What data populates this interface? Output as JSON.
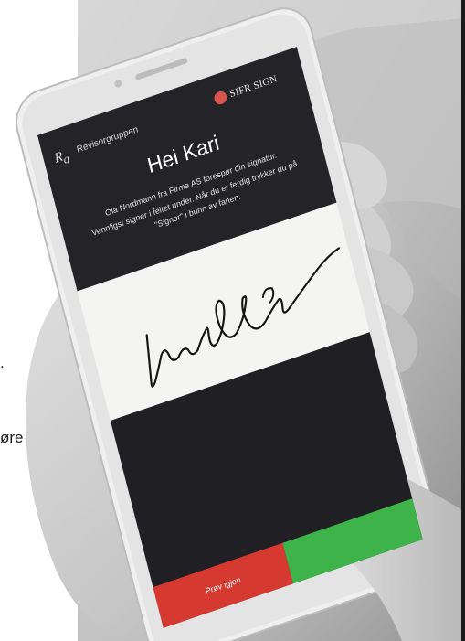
{
  "left_text": {
    "line1": ".",
    "line2": "øre"
  },
  "app": {
    "org_name": "Revisorgruppen",
    "brand_name": "SIFR SIGN",
    "greeting": "Hei Kari",
    "request": "Ola Nordmann fra Firma AS forespør din signatur.",
    "instruction_line1": "Vennligst signer i feltet under. Når du er ferdig trykker du på",
    "instruction_line2": "\"Signer\" i bunn av fanen.",
    "retry_label": "Prøv igjen",
    "sign_label": ""
  },
  "colors": {
    "screen_dark": "#242428",
    "sign_area": "#f4f4f2",
    "retry_red": "#d6392f",
    "sign_green": "#3db34a",
    "brand_red": "#d9534f"
  },
  "icons": {
    "org_logo": "rg-monogram-icon",
    "brand_logo": "sifr-sign-logo-icon"
  }
}
